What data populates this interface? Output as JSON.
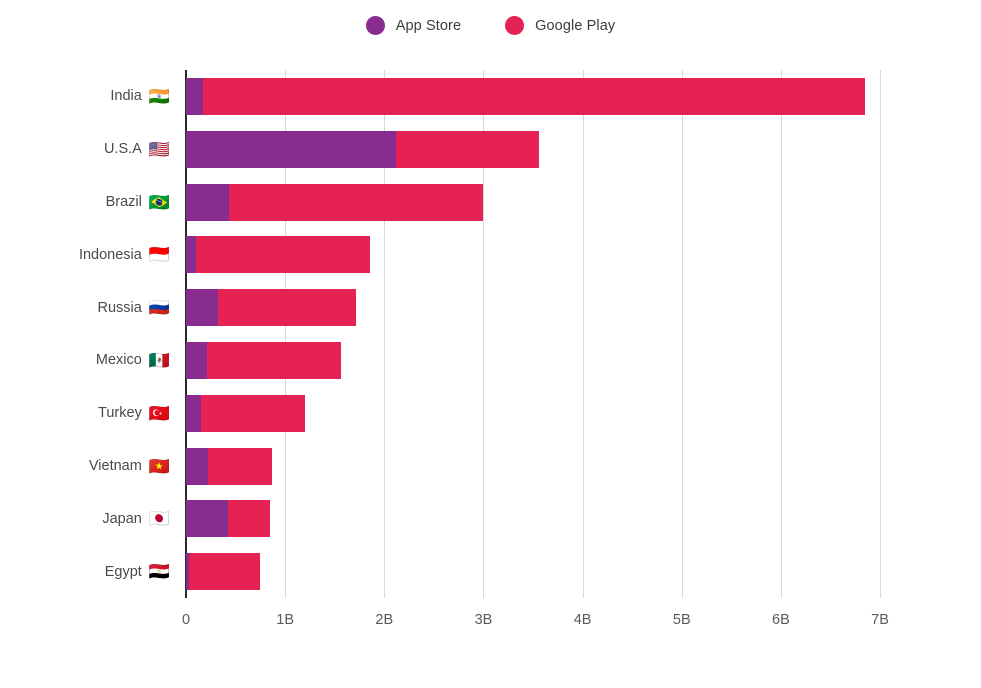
{
  "legend": {
    "position": "top-center",
    "items": [
      {
        "label": "App Store",
        "color": "#882D8F",
        "marker": "circle"
      },
      {
        "label": "Google Play",
        "color": "#E52253",
        "marker": "circle"
      }
    ]
  },
  "axis": {
    "x_ticks": [
      "0",
      "1B",
      "2B",
      "3B",
      "4B",
      "5B",
      "6B",
      "7B"
    ],
    "x_tick_values": [
      0,
      1,
      2,
      3,
      4,
      5,
      6,
      7
    ],
    "xlabel": "",
    "ylabel": ""
  },
  "flags": {
    "India": "🇮🇳",
    "U.S.A": "🇺🇸",
    "Brazil": "🇧🇷",
    "Indonesia": "🇮🇩",
    "Russia": "🇷🇺",
    "Mexico": "🇲🇽",
    "Turkey": "🇹🇷",
    "Vietnam": "🇻🇳",
    "Japan": "🇯🇵",
    "Egypt": "🇪🇬"
  },
  "chart_data": {
    "type": "bar",
    "orientation": "horizontal",
    "stacked": true,
    "title": "",
    "xlabel": "",
    "ylabel": "",
    "xlim": [
      0,
      7.0
    ],
    "grid": true,
    "legend_position": "top-center",
    "unit": "B",
    "categories": [
      "India",
      "U.S.A",
      "Brazil",
      "Indonesia",
      "Russia",
      "Mexico",
      "Turkey",
      "Vietnam",
      "Japan",
      "Egypt"
    ],
    "series": [
      {
        "name": "App Store",
        "color": "#882D8F",
        "values": [
          0.17,
          2.12,
          0.43,
          0.1,
          0.32,
          0.21,
          0.15,
          0.22,
          0.42,
          0.03
        ]
      },
      {
        "name": "Google Play",
        "color": "#E52253",
        "values": [
          6.68,
          1.44,
          2.57,
          1.76,
          1.39,
          1.35,
          1.05,
          0.65,
          0.43,
          0.72
        ]
      }
    ],
    "totals": [
      6.85,
      3.56,
      3.0,
      1.86,
      1.71,
      1.56,
      1.2,
      0.87,
      0.85,
      0.75
    ]
  }
}
